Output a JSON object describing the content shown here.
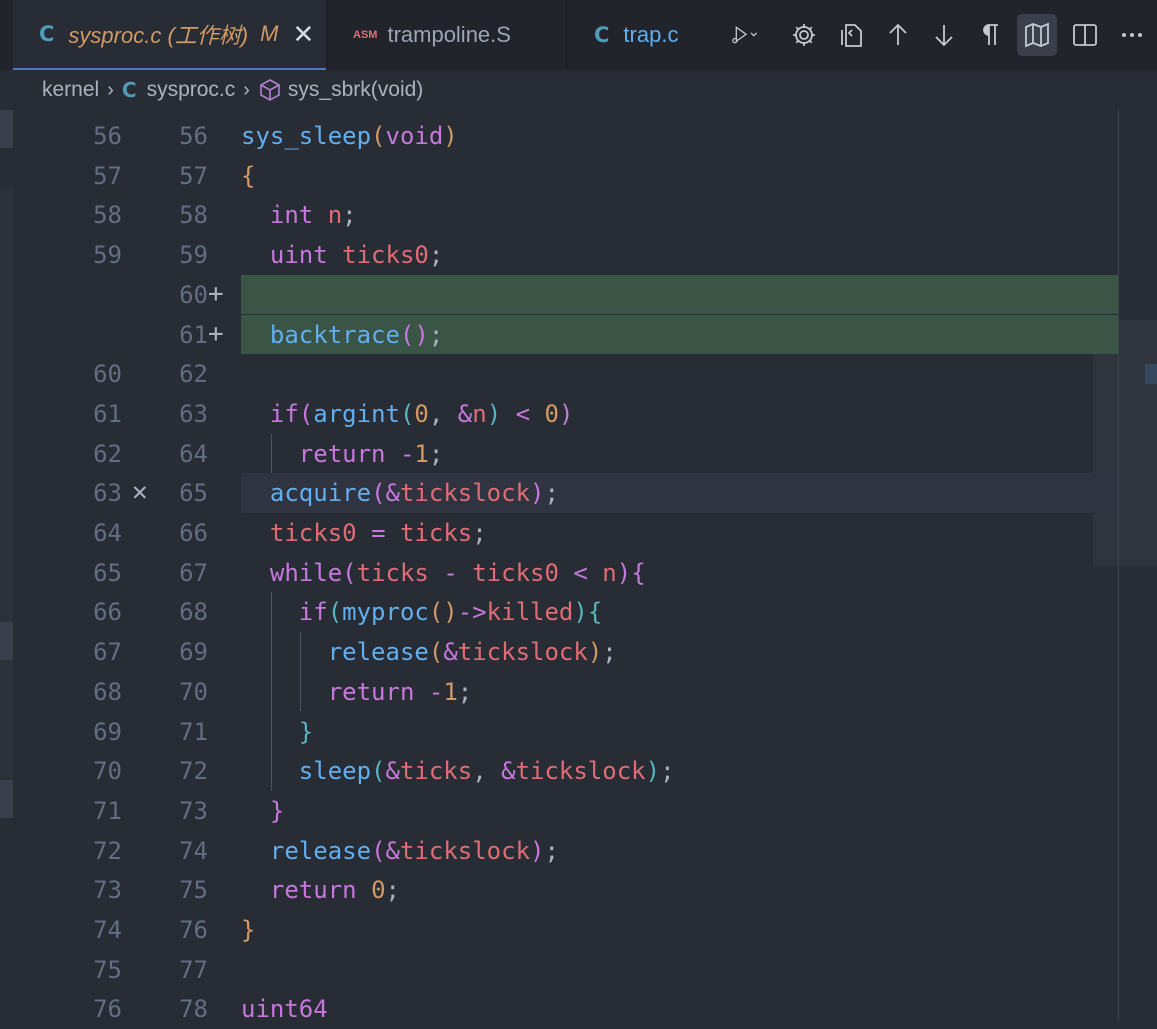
{
  "tabs": [
    {
      "icon": "C",
      "label": "sysproc.c (工作树)",
      "modified": "M",
      "close": "✕"
    },
    {
      "icon": "ASM",
      "label": "trampoline.S"
    },
    {
      "icon": "C",
      "label": "trap.c"
    }
  ],
  "breadcrumb": {
    "folder": "kernel",
    "file_icon": "C",
    "file": "sysproc.c",
    "symbol": "sys_sbrk(void)"
  },
  "gutter_marks": {
    "added": "+",
    "removed": "✕"
  },
  "lines": [
    {
      "old": "56",
      "new": "56",
      "tokens": [
        [
          "fn",
          "sys_sleep"
        ],
        [
          "p1",
          "("
        ],
        [
          "kw",
          "void"
        ],
        [
          "p1",
          ")"
        ]
      ]
    },
    {
      "old": "57",
      "new": "57",
      "tokens": [
        [
          "p1",
          "{"
        ]
      ]
    },
    {
      "old": "58",
      "new": "58",
      "tokens": [
        [
          "pl",
          "  "
        ],
        [
          "kw",
          "int"
        ],
        [
          "pl",
          " "
        ],
        [
          "var",
          "n"
        ],
        [
          "pl",
          ";"
        ]
      ]
    },
    {
      "old": "59",
      "new": "59",
      "tokens": [
        [
          "pl",
          "  "
        ],
        [
          "kw",
          "uint"
        ],
        [
          "pl",
          " "
        ],
        [
          "var",
          "ticks0"
        ],
        [
          "pl",
          ";"
        ]
      ]
    },
    {
      "old": "",
      "new": "60",
      "added": true,
      "tokens": []
    },
    {
      "old": "",
      "new": "61",
      "added": true,
      "tokens": [
        [
          "pl",
          "  "
        ],
        [
          "fn",
          "backtrace"
        ],
        [
          "p2",
          "()"
        ],
        [
          "pl",
          ";"
        ]
      ]
    },
    {
      "old": "60",
      "new": "62",
      "tokens": []
    },
    {
      "old": "61",
      "new": "63",
      "tokens": [
        [
          "pl",
          "  "
        ],
        [
          "kw",
          "if"
        ],
        [
          "p2",
          "("
        ],
        [
          "fn",
          "argint"
        ],
        [
          "p3",
          "("
        ],
        [
          "num",
          "0"
        ],
        [
          "pl",
          ", "
        ],
        [
          "op",
          "&"
        ],
        [
          "var",
          "n"
        ],
        [
          "p3",
          ")"
        ],
        [
          "pl",
          " "
        ],
        [
          "op",
          "<"
        ],
        [
          "pl",
          " "
        ],
        [
          "num",
          "0"
        ],
        [
          "p2",
          ")"
        ]
      ]
    },
    {
      "old": "62",
      "new": "64",
      "tokens": [
        [
          "pl",
          "    "
        ],
        [
          "kw",
          "return"
        ],
        [
          "pl",
          " "
        ],
        [
          "op",
          "-"
        ],
        [
          "num",
          "1"
        ],
        [
          "pl",
          ";"
        ]
      ]
    },
    {
      "old": "63",
      "new": "65",
      "removed": true,
      "current": true,
      "tokens": [
        [
          "pl",
          "  "
        ],
        [
          "fn",
          "acquire"
        ],
        [
          "p2",
          "("
        ],
        [
          "op",
          "&"
        ],
        [
          "var",
          "tickslock"
        ],
        [
          "p2",
          ")"
        ],
        [
          "pl",
          ";"
        ]
      ]
    },
    {
      "old": "64",
      "new": "66",
      "tokens": [
        [
          "pl",
          "  "
        ],
        [
          "var",
          "ticks0"
        ],
        [
          "pl",
          " "
        ],
        [
          "op",
          "="
        ],
        [
          "pl",
          " "
        ],
        [
          "var",
          "ticks"
        ],
        [
          "pl",
          ";"
        ]
      ]
    },
    {
      "old": "65",
      "new": "67",
      "tokens": [
        [
          "pl",
          "  "
        ],
        [
          "kw",
          "while"
        ],
        [
          "p2",
          "("
        ],
        [
          "var",
          "ticks"
        ],
        [
          "pl",
          " "
        ],
        [
          "op",
          "-"
        ],
        [
          "pl",
          " "
        ],
        [
          "var",
          "ticks0"
        ],
        [
          "pl",
          " "
        ],
        [
          "op",
          "<"
        ],
        [
          "pl",
          " "
        ],
        [
          "var",
          "n"
        ],
        [
          "p2",
          ")"
        ],
        [
          "p2",
          "{"
        ]
      ]
    },
    {
      "old": "66",
      "new": "68",
      "tokens": [
        [
          "pl",
          "    "
        ],
        [
          "kw",
          "if"
        ],
        [
          "p3",
          "("
        ],
        [
          "fn",
          "myproc"
        ],
        [
          "p1",
          "()"
        ],
        [
          "op",
          "->"
        ],
        [
          "var",
          "killed"
        ],
        [
          "p3",
          ")"
        ],
        [
          "p3",
          "{"
        ]
      ]
    },
    {
      "old": "67",
      "new": "69",
      "tokens": [
        [
          "pl",
          "      "
        ],
        [
          "fn",
          "release"
        ],
        [
          "p1",
          "("
        ],
        [
          "op",
          "&"
        ],
        [
          "var",
          "tickslock"
        ],
        [
          "p1",
          ")"
        ],
        [
          "pl",
          ";"
        ]
      ]
    },
    {
      "old": "68",
      "new": "70",
      "tokens": [
        [
          "pl",
          "      "
        ],
        [
          "kw",
          "return"
        ],
        [
          "pl",
          " "
        ],
        [
          "op",
          "-"
        ],
        [
          "num",
          "1"
        ],
        [
          "pl",
          ";"
        ]
      ]
    },
    {
      "old": "69",
      "new": "71",
      "tokens": [
        [
          "pl",
          "    "
        ],
        [
          "p3",
          "}"
        ]
      ]
    },
    {
      "old": "70",
      "new": "72",
      "tokens": [
        [
          "pl",
          "    "
        ],
        [
          "fn",
          "sleep"
        ],
        [
          "p3",
          "("
        ],
        [
          "op",
          "&"
        ],
        [
          "var",
          "ticks"
        ],
        [
          "pl",
          ", "
        ],
        [
          "op",
          "&"
        ],
        [
          "var",
          "tickslock"
        ],
        [
          "p3",
          ")"
        ],
        [
          "pl",
          ";"
        ]
      ]
    },
    {
      "old": "71",
      "new": "73",
      "tokens": [
        [
          "pl",
          "  "
        ],
        [
          "p2",
          "}"
        ]
      ]
    },
    {
      "old": "72",
      "new": "74",
      "tokens": [
        [
          "pl",
          "  "
        ],
        [
          "fn",
          "release"
        ],
        [
          "p2",
          "("
        ],
        [
          "op",
          "&"
        ],
        [
          "var",
          "tickslock"
        ],
        [
          "p2",
          ")"
        ],
        [
          "pl",
          ";"
        ]
      ]
    },
    {
      "old": "73",
      "new": "75",
      "tokens": [
        [
          "pl",
          "  "
        ],
        [
          "kw",
          "return"
        ],
        [
          "pl",
          " "
        ],
        [
          "num",
          "0"
        ],
        [
          "pl",
          ";"
        ]
      ]
    },
    {
      "old": "74",
      "new": "76",
      "tokens": [
        [
          "p1",
          "}"
        ]
      ]
    },
    {
      "old": "75",
      "new": "77",
      "tokens": []
    },
    {
      "old": "76",
      "new": "78",
      "tokens": [
        [
          "kw",
          "uint64"
        ]
      ]
    }
  ]
}
